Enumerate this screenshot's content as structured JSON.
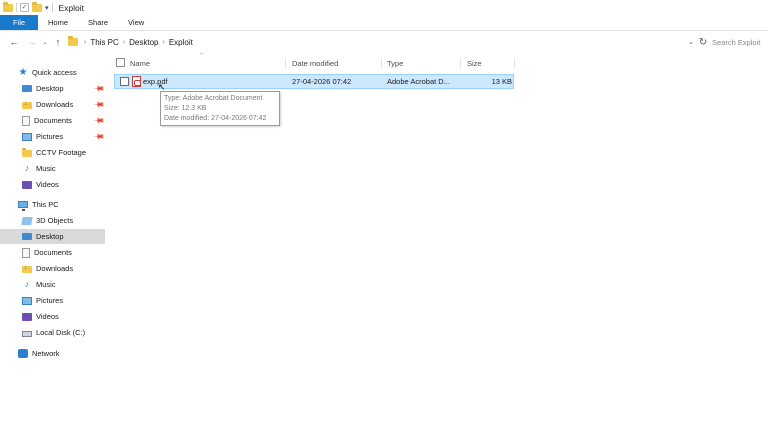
{
  "window": {
    "title": "Exploit"
  },
  "ribbon": {
    "tabs": [
      "File",
      "Home",
      "Share",
      "View"
    ]
  },
  "address": {
    "crumbs": [
      "This PC",
      "Desktop",
      "Exploit"
    ],
    "search_placeholder": "Search Exploit"
  },
  "nav": {
    "quick_access": {
      "label": "Quick access",
      "items": [
        {
          "label": "Desktop",
          "icon": "desktop-icon",
          "pinned": true
        },
        {
          "label": "Downloads",
          "icon": "downloads-icon",
          "pinned": true
        },
        {
          "label": "Documents",
          "icon": "documents-icon",
          "pinned": true
        },
        {
          "label": "Pictures",
          "icon": "pictures-icon",
          "pinned": true
        },
        {
          "label": "CCTV Footage",
          "icon": "folder-icon",
          "pinned": false
        },
        {
          "label": "Music",
          "icon": "music-icon",
          "pinned": false
        },
        {
          "label": "Videos",
          "icon": "videos-icon",
          "pinned": false
        }
      ]
    },
    "this_pc": {
      "label": "This PC",
      "items": [
        {
          "label": "3D Objects",
          "icon": "3d-objects-icon"
        },
        {
          "label": "Desktop",
          "icon": "desktop-icon",
          "selected": true
        },
        {
          "label": "Documents",
          "icon": "documents-icon"
        },
        {
          "label": "Downloads",
          "icon": "downloads-icon"
        },
        {
          "label": "Music",
          "icon": "music-icon"
        },
        {
          "label": "Pictures",
          "icon": "pictures-icon"
        },
        {
          "label": "Videos",
          "icon": "videos-icon"
        },
        {
          "label": "Local Disk (C:)",
          "icon": "local-disk-icon"
        }
      ]
    },
    "network": {
      "label": "Network"
    }
  },
  "columns": {
    "name": "Name",
    "date": "Date modified",
    "type": "Type",
    "size": "Size"
  },
  "files": [
    {
      "name": "exp.pdf",
      "date": "27-04-2026 07:42",
      "type": "Adobe Acrobat D...",
      "size": "13 KB",
      "icon": "pdf-file-icon"
    }
  ],
  "tooltip": {
    "type": "Type: Adobe Acrobat Document",
    "size": "Size: 12.3 KB",
    "date": "Date modified: 27-04-2026 07:42"
  },
  "colors": {
    "accent": "#1979ca",
    "selection": "#cce8ff",
    "nav_selected": "#d9d9d9"
  }
}
